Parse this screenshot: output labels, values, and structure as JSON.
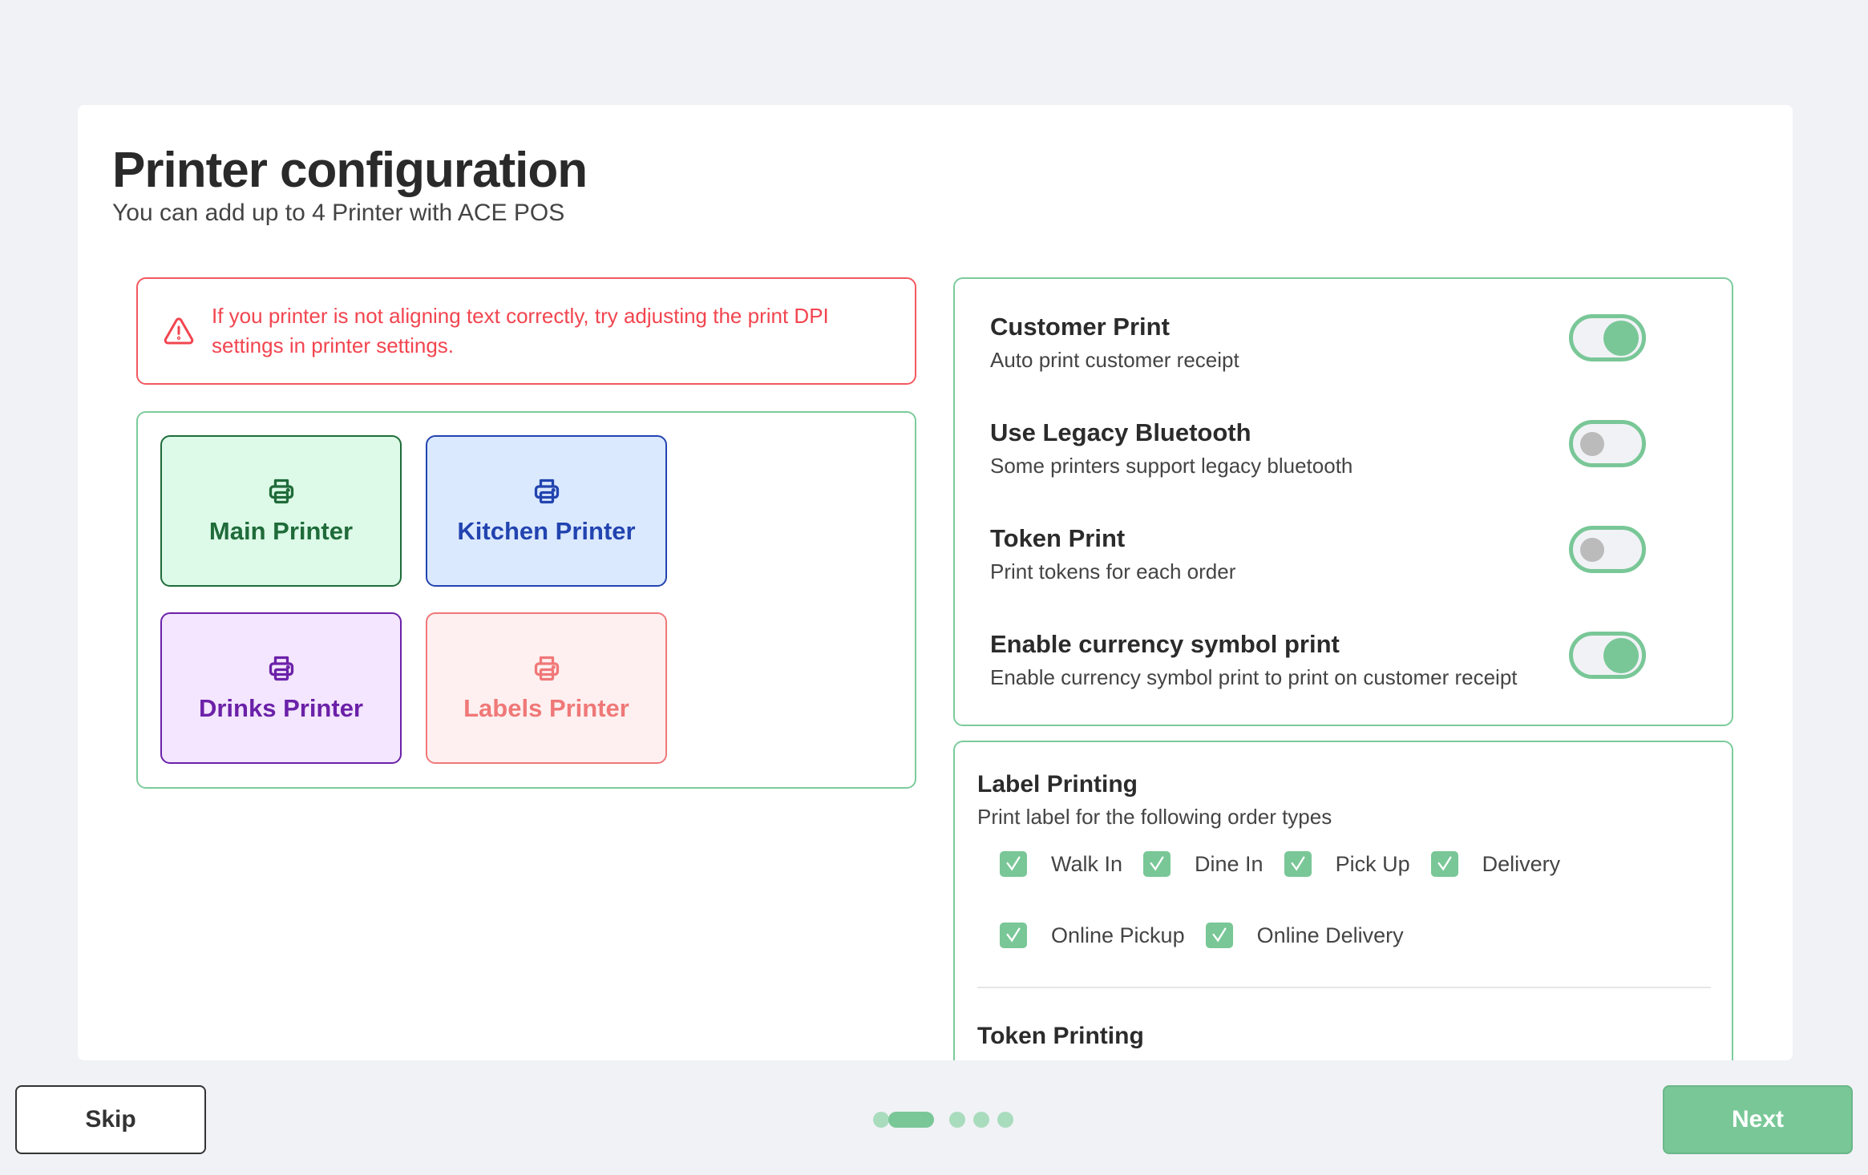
{
  "header": {
    "title": "Printer configuration",
    "subtitle": "You can add up to 4 Printer with ACE POS"
  },
  "alert": {
    "icon": "warning-triangle-icon",
    "text": "If you printer is not aligning text correctly, try adjusting the print DPI settings in printer settings.",
    "color": "#f2454f"
  },
  "printers": [
    {
      "label": "Main Printer",
      "color": "#1f6b3a",
      "bg": "#dcfae7"
    },
    {
      "label": "Kitchen Printer",
      "color": "#2244b0",
      "bg": "#dbe9fe"
    },
    {
      "label": "Drinks Printer",
      "color": "#6b21a8",
      "bg": "#f3e6fe"
    },
    {
      "label": "Labels Printer",
      "color": "#f07878",
      "bg": "#fef0f0"
    }
  ],
  "settings": [
    {
      "title": "Customer Print",
      "subtitle": "Auto print customer receipt",
      "enabled": true
    },
    {
      "title": "Use Legacy Bluetooth",
      "subtitle": "Some printers support legacy bluetooth",
      "enabled": false
    },
    {
      "title": "Token Print",
      "subtitle": "Print tokens for each order",
      "enabled": false
    },
    {
      "title": "Enable currency symbol print",
      "subtitle": "Enable currency symbol print to print on customer receipt",
      "enabled": true
    }
  ],
  "label_printing": {
    "title": "Label Printing",
    "subtitle": "Print label for the following order types",
    "options": [
      {
        "label": "Walk In",
        "checked": true
      },
      {
        "label": "Dine In",
        "checked": true
      },
      {
        "label": "Pick Up",
        "checked": true
      },
      {
        "label": "Delivery",
        "checked": true
      },
      {
        "label": "Online Pickup",
        "checked": true
      },
      {
        "label": "Online Delivery",
        "checked": true
      }
    ]
  },
  "token_printing": {
    "title": "Token Printing"
  },
  "footer": {
    "skip": "Skip",
    "next": "Next",
    "steps_total": 5,
    "current_step": 2
  },
  "accent": "#79c797"
}
